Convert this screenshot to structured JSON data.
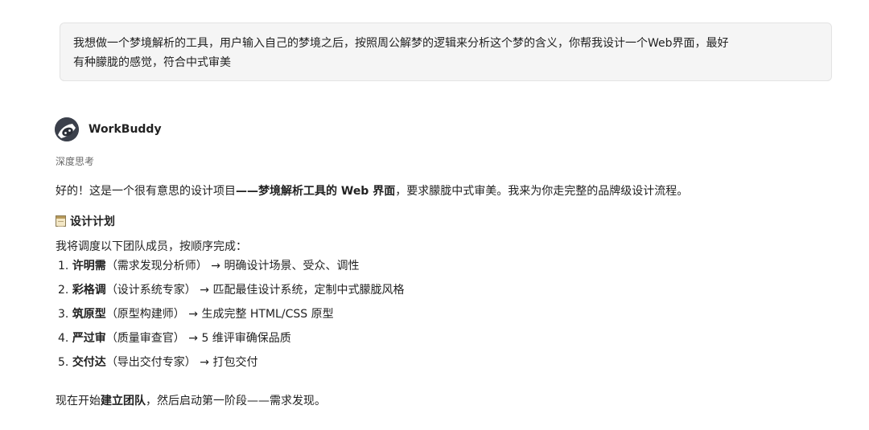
{
  "user_message": {
    "line1": "我想做一个梦境解析的工具，用户输入自己的梦境之后，按照周公解梦的逻辑来分析这个梦的含义，你帮我设计一个Web界面，最好",
    "line2": "有种朦胧的感觉，符合中式审美"
  },
  "assistant": {
    "name": "WorkBuddy",
    "avatar_icon": "robot-avatar-icon",
    "thinking_label": "深度思考",
    "intro": {
      "before": "好的！这是一个很有意思的设计项目",
      "bold": "——梦境解析工具的 Web 界面",
      "after": "，要求朦胧中式审美。我来为你走完整的品牌级设计流程。"
    },
    "plan": {
      "icon": "notepad-icon",
      "title": "设计计划",
      "intro": "我将调度以下团队成员，按顺序完成：",
      "steps": [
        {
          "num": "1.",
          "name": "许明需",
          "role": "（需求发现分析师）",
          "task": " → 明确设计场景、受众、调性"
        },
        {
          "num": "2.",
          "name": "彩格调",
          "role": "（设计系统专家）",
          "task": " → 匹配最佳设计系统，定制中式朦胧风格"
        },
        {
          "num": "3.",
          "name": "筑原型",
          "role": "（原型构建师）",
          "task": " → 生成完整 HTML/CSS 原型"
        },
        {
          "num": "4.",
          "name": "严过审",
          "role": "（质量审查官）",
          "task": " → 5 维评审确保品质"
        },
        {
          "num": "5.",
          "name": "交付达",
          "role": "（导出交付专家）",
          "task": " → 打包交付"
        }
      ]
    },
    "closing": {
      "before": "现在开始",
      "bold": "建立团队",
      "after": "，然后启动第一阶段——需求发现。"
    }
  }
}
